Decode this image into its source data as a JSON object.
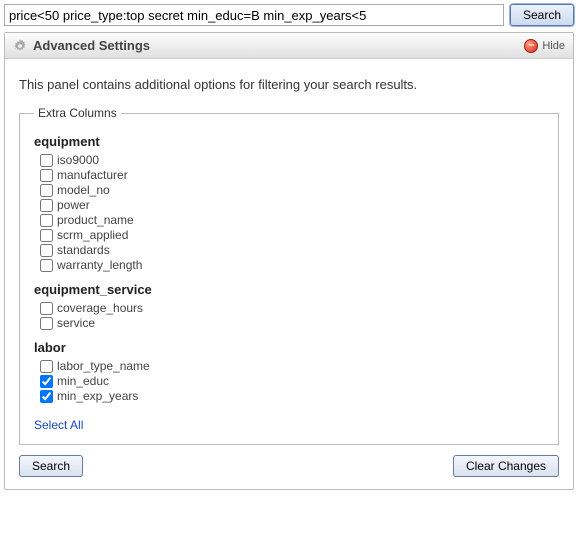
{
  "search": {
    "value": "price<50 price_type:top secret min_educ=B min_exp_years<5",
    "top_button": "Search"
  },
  "panel": {
    "title": "Advanced Settings",
    "hide_label": "Hide",
    "description": "This panel contains additional options for filtering your search results.",
    "legend": "Extra Columns"
  },
  "groups": {
    "equipment": {
      "title": "equipment",
      "items": [
        {
          "label": "iso9000",
          "checked": false
        },
        {
          "label": "manufacturer",
          "checked": false
        },
        {
          "label": "model_no",
          "checked": false
        },
        {
          "label": "power",
          "checked": false
        },
        {
          "label": "product_name",
          "checked": false
        },
        {
          "label": "scrm_applied",
          "checked": false
        },
        {
          "label": "standards",
          "checked": false
        },
        {
          "label": "warranty_length",
          "checked": false
        }
      ]
    },
    "equipment_service": {
      "title": "equipment_service",
      "items": [
        {
          "label": "coverage_hours",
          "checked": false
        },
        {
          "label": "service",
          "checked": false
        }
      ]
    },
    "labor": {
      "title": "labor",
      "items": [
        {
          "label": "labor_type_name",
          "checked": false
        },
        {
          "label": "min_educ",
          "checked": true
        },
        {
          "label": "min_exp_years",
          "checked": true
        }
      ]
    }
  },
  "actions": {
    "select_all": "Select All",
    "search": "Search",
    "clear": "Clear Changes"
  }
}
